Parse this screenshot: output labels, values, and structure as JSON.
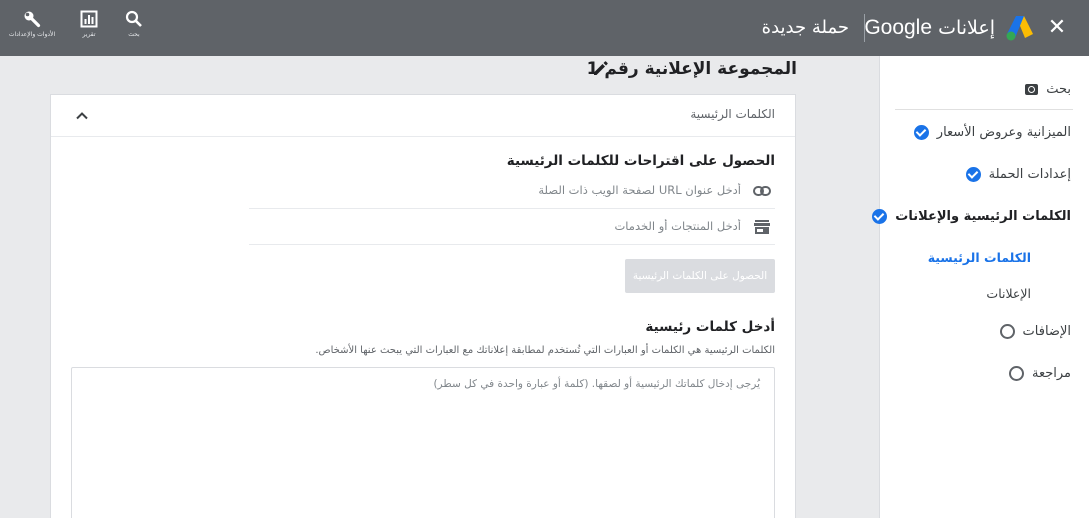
{
  "header": {
    "brand_name": "Google",
    "brand_product": "إعلانات",
    "campaign_title": "حملة جديدة",
    "close_glyph": "✕",
    "tools": [
      {
        "label": "بحث",
        "icon": "search-icon"
      },
      {
        "label": "تقرير",
        "icon": "report-icon"
      },
      {
        "label": "الأدوات والإعدادات",
        "icon": "wrench-icon"
      }
    ]
  },
  "sidebar": {
    "items": [
      {
        "label": "بحث",
        "state": "campaign-type"
      },
      {
        "label": "الميزانية وعروض الأسعار",
        "state": "done"
      },
      {
        "label": "إعدادات الحملة",
        "state": "done"
      },
      {
        "label": "الكلمات الرئيسية والإعلانات",
        "state": "done"
      },
      {
        "label": "الإضافات",
        "state": "todo"
      },
      {
        "label": "مراجعة",
        "state": "todo"
      }
    ],
    "subitems": [
      {
        "label": "الكلمات الرئيسية",
        "active": true
      },
      {
        "label": "الإعلانات",
        "active": false
      }
    ]
  },
  "main": {
    "ad_group_title": "المجموعة الإعلانية رقم 1",
    "card_title": "الكلمات الرئيسية",
    "suggestions_title": "الحصول على اقتراحات للكلمات الرئيسية",
    "url_placeholder": "أدخل عنوان URL لصفحة الويب ذات الصلة",
    "products_placeholder": "أدخل المنتجات أو الخدمات",
    "get_keywords_button": "الحصول على الكلمات الرئيسية",
    "enter_keywords_title": "أدخل كلمات رئيسية",
    "keywords_description": "الكلمات الرئيسية هي الكلمات أو العبارات التي تُستخدم لمطابقة إعلاناتك مع العبارات التي يبحث عنها الأشخاص.",
    "keywords_placeholder": "يُرجى إدخال كلماتك الرئيسية أو لصقها. (كلمة أو عبارة واحدة في كل سطر)"
  },
  "colors": {
    "header_bg": "#5f6368",
    "accent_blue": "#1a73e8",
    "logo_yellow": "#fbbc04",
    "logo_green": "#34a853"
  }
}
